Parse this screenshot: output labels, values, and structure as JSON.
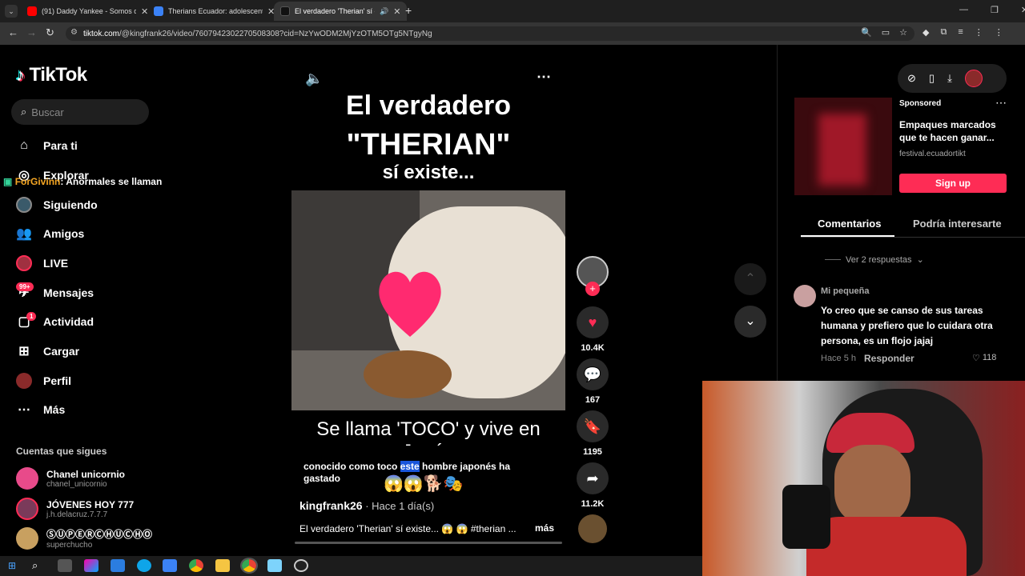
{
  "browser": {
    "tabs": [
      {
        "title": "(91) Daddy Yankee - Somos de",
        "color": "#ff0000"
      },
      {
        "title": "Therians Ecuador: adolescente",
        "color": "#3b82f6"
      },
      {
        "title": "El verdadero 'Therian' sí exi",
        "color": "#222222"
      }
    ],
    "url_host": "tiktok.com",
    "url_path": "/@kingfrank26/video/7607942302270508308?cid=NzYwODM2MjYzOTM5OTg5NTgyNg"
  },
  "sidebar": {
    "logo": "TikTok",
    "search_placeholder": "Buscar",
    "items": [
      {
        "label": "Para ti",
        "icon": "home-icon"
      },
      {
        "label": "Explorar",
        "icon": "compass-icon"
      },
      {
        "label": "Siguiendo",
        "icon": "following-avatar-icon"
      },
      {
        "label": "Amigos",
        "icon": "friends-icon"
      },
      {
        "label": "LIVE",
        "icon": "live-icon"
      },
      {
        "label": "Mensajes",
        "icon": "messages-icon",
        "badge": "99+"
      },
      {
        "label": "Actividad",
        "icon": "activity-icon",
        "badge": "1"
      },
      {
        "label": "Cargar",
        "icon": "upload-icon"
      },
      {
        "label": "Perfil",
        "icon": "profile-icon"
      },
      {
        "label": "Más",
        "icon": "more-icon"
      }
    ],
    "following_heading": "Cuentas que sigues",
    "accounts": [
      {
        "name": "Chanel unicornio",
        "handle": "chanel_unicornio"
      },
      {
        "name": "JÓVENES HOY 777",
        "handle": "j.h.delacruz.7.7.7"
      },
      {
        "name": "ⓈⓊⓅⒺⓇⒸⒽⓊⒸⒽⓄ",
        "handle": "superchucho"
      }
    ]
  },
  "overlay_chat": {
    "user": "ForGivinn",
    "message": ": Anormales se llaman"
  },
  "video": {
    "title_line1": "El verdadero",
    "title_line2": "\"THERIAN\"",
    "title_line3": "sí existe...",
    "bottom_caption": "Se llama 'TOCO' y vive en Japón",
    "subtitle_pre": "conocido como toco ",
    "subtitle_hl": "este",
    "subtitle_post": " hombre japonés ha gastado",
    "author": "kingfrank26",
    "time": " · Hace 1 día(s)",
    "desc": "El verdadero 'Therian' sí existe... 😱 😱 #therian ...",
    "more": "más",
    "likes": "10.4K",
    "comments": "167",
    "saves": "1195",
    "shares": "11.2K"
  },
  "right": {
    "sponsored_label": "Sponsored",
    "ad_title": "Empaques marcados que te hacen ganar...",
    "ad_domain": "festival.ecuadortikt",
    "signup": "Sign up",
    "tab_comments": "Comentarios",
    "tab_interest": "Podría interesarte",
    "replies": "Ver 2 respuestas",
    "comment_user": "Mi pequeña",
    "comment_text": "Yo creo que se canso de sus tareas humana y prefiero que lo cuidara otra persona, es un flojo jajaj",
    "comment_time": "Hace 5 h",
    "reply_btn": "Responder",
    "comment_likes": "118"
  }
}
